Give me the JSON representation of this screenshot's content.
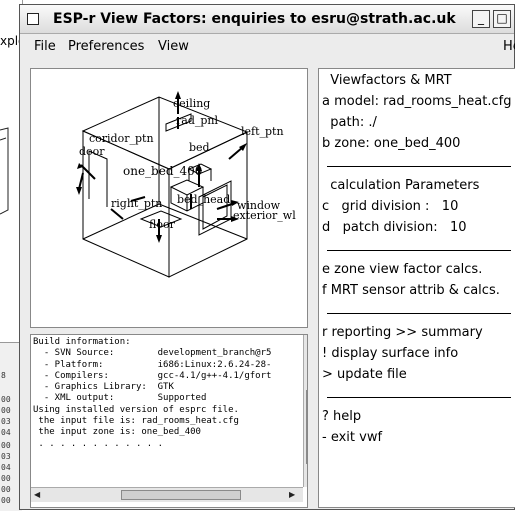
{
  "background_window": {
    "fragment": "xplo",
    "numbers": [
      "8",
      "00",
      "00",
      "03",
      "04",
      "00",
      "03",
      "04",
      "00",
      "00",
      "00"
    ]
  },
  "window": {
    "title": "ESP-r View Factors: enquiries to esru@strath.ac.uk",
    "buttons": {
      "minimize": "_",
      "maximize": "□",
      "close": "×"
    }
  },
  "menubar": {
    "file": "File",
    "preferences": "Preferences",
    "view": "View",
    "help": "He"
  },
  "model_view": {
    "labels": {
      "ceiling": "ceiling",
      "rad_pnl": "rad_pnl",
      "coridor_ptn": "coridor_ptn",
      "left_ptn": "left_ptn",
      "door": "door",
      "bed": "bed",
      "one_bed": "one_bed_400",
      "bed_head": "bed_head",
      "right_ptn": "right_ptn",
      "window": "window",
      "exterior_wl": "exterior_wl",
      "floor": "floor"
    }
  },
  "log": {
    "lines": [
      "",
      "Build information:",
      "  - SVN Source:        development_branch@r5",
      "  - Platform:          i686:Linux:2.6.24-28-",
      "  - Compilers:         gcc-4.1/g++-4.1/gfort",
      "  - Graphics Library:  GTK",
      "  - XML output:        Supported",
      "",
      "Using installed version of esprc file.",
      " the input file is: rad_rooms_heat.cfg",
      " the input zone is: one_bed_400",
      "",
      " . . . . . . . . . . . ."
    ]
  },
  "menu": {
    "items": [
      "  Viewfactors & MRT",
      "a model: rad_rooms_heat.cfg",
      "  path: ./",
      "b zone: one_bed_400",
      "",
      "  calculation Parameters",
      "c   grid division :   10",
      "d   patch division:   10",
      "",
      "e zone view factor calcs.",
      "f MRT sensor attrib & calcs.",
      "",
      "r reporting >> summary",
      "! display surface info",
      "> update file",
      "",
      "? help",
      "- exit vwf"
    ]
  }
}
